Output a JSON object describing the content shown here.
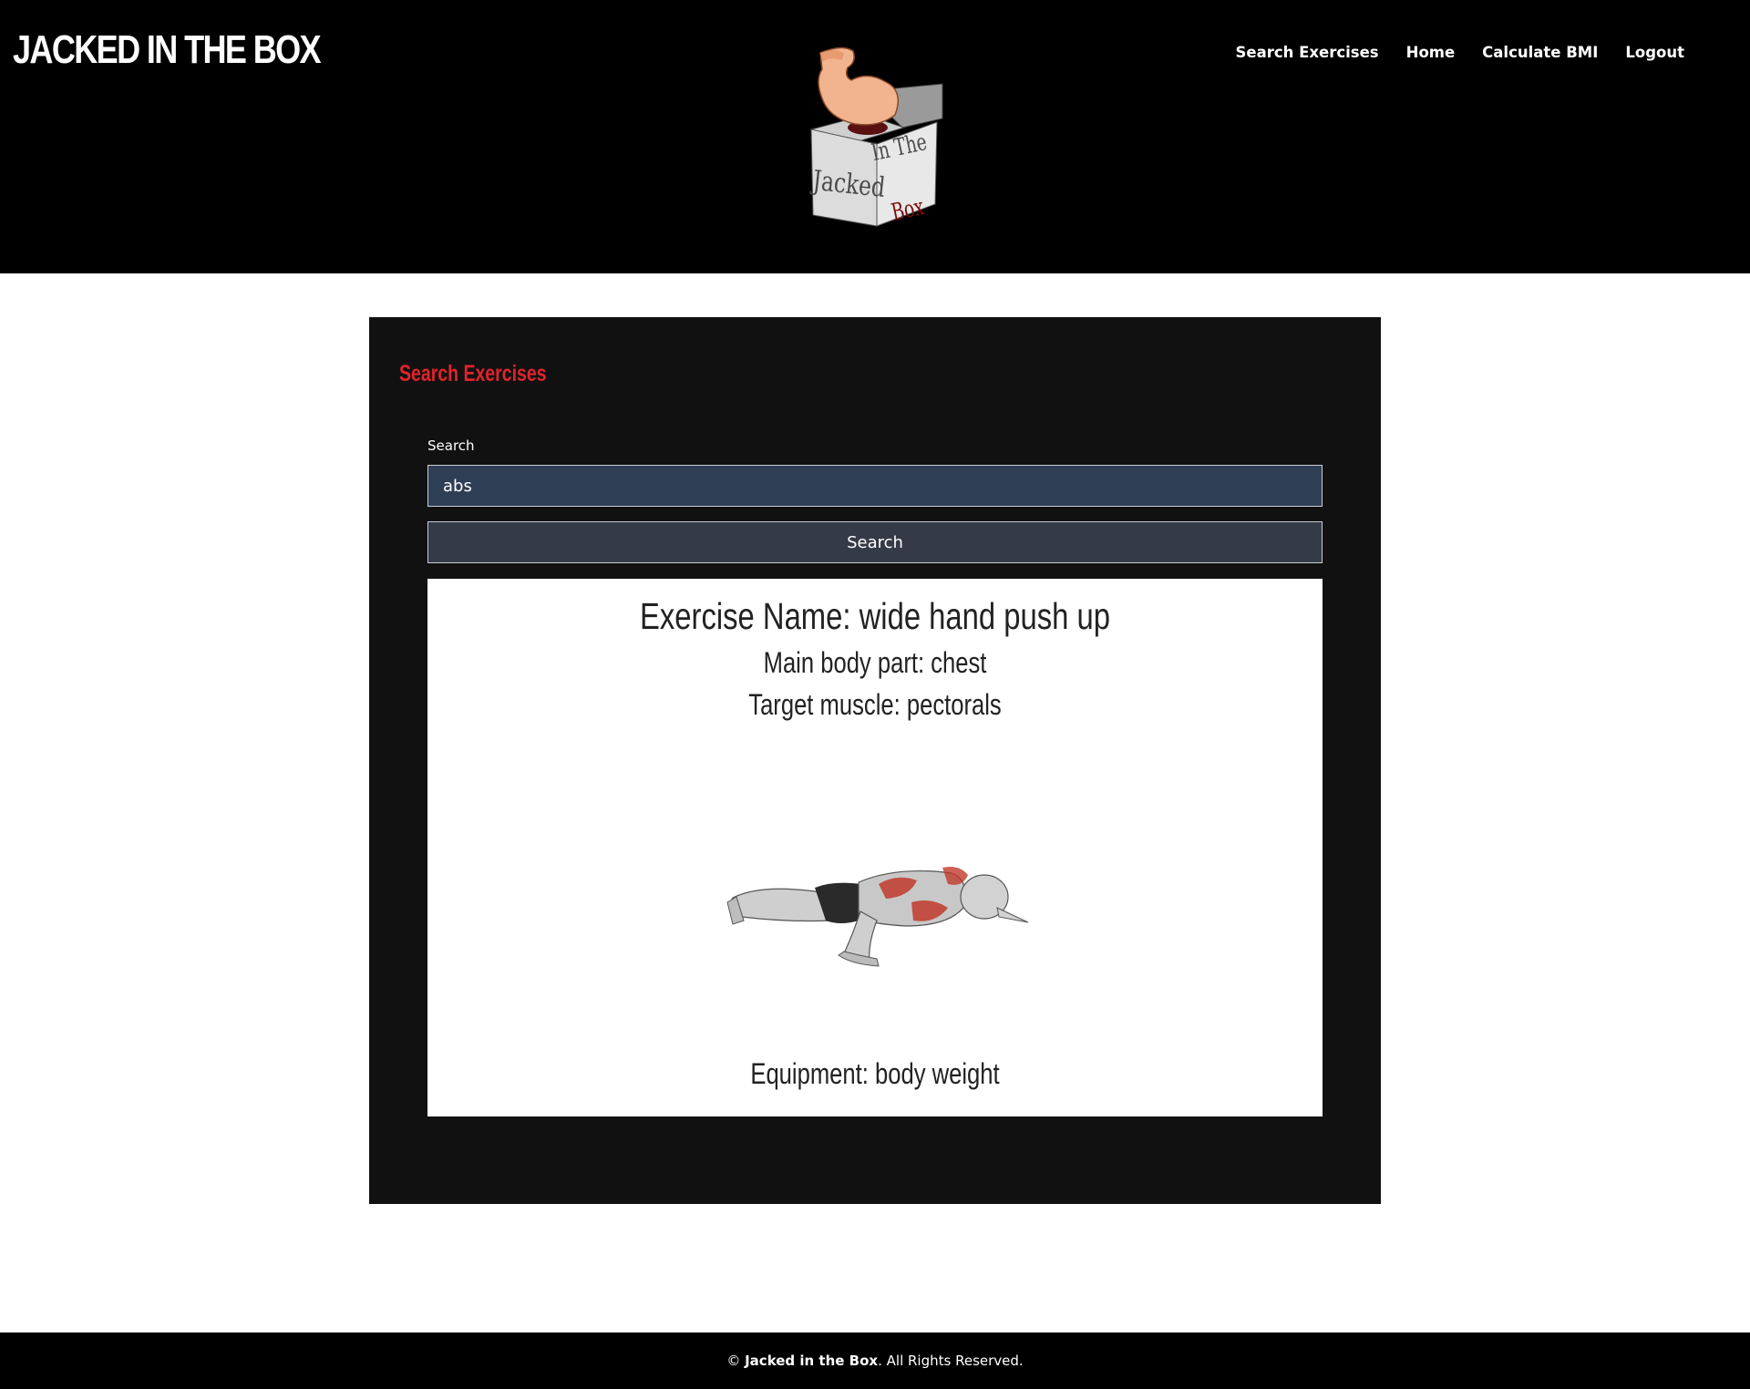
{
  "header": {
    "brand": "JACKED IN THE BOX",
    "nav": [
      "Search Exercises",
      "Home",
      "Calculate BMI",
      "Logout"
    ],
    "logo_text": [
      "Jacked",
      "In The",
      "Box"
    ]
  },
  "card": {
    "title": "Search Exercises",
    "search_label": "Search",
    "search_value": "abs",
    "search_button": "Search"
  },
  "result": {
    "name": "Exercise Name: wide hand push up",
    "body_part": "Main body part: chest",
    "target": "Target muscle: pectorals",
    "equipment": "Equipment: body weight"
  },
  "footer": {
    "copyright_symbol": "©",
    "brand": "Jacked in the Box",
    "rights": ". All Rights Reserved."
  },
  "colors": {
    "header_bg": "#000000",
    "card_bg": "#111111",
    "accent_red": "#e0242b",
    "input_bg": "#2e3e54",
    "button_bg": "#343a46"
  }
}
